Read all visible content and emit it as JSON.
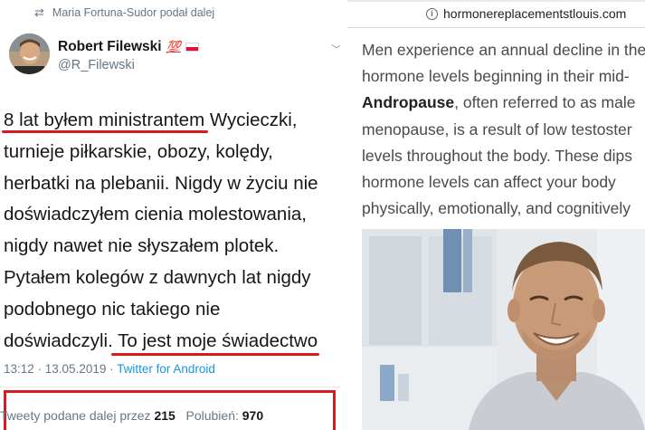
{
  "tweet": {
    "retweet_label": "Maria Fortuna-Sudor podał dalej",
    "author_name": "Robert Filewski",
    "author_badge": "💯",
    "handle": "@R_Filewski",
    "text_lines": [
      {
        "underlined": "8 lat byłem ministrantem",
        "rest": " Wycieczki,"
      },
      {
        "text": "turnieje piłkarskie, obozy, kolędy,"
      },
      {
        "text": "herbatki na plebanii. Nigdy w życiu nie"
      },
      {
        "text": "doświadczyłem cienia molestowania,"
      },
      {
        "text": "nigdy nawet nie słyszałem plotek."
      },
      {
        "text": "Pytałem kolegów z dawnych lat nigdy"
      },
      {
        "text": "podobnego nic takiego nie"
      },
      {
        "prefix": "doświadczyli.",
        "underlined": " To jest moje świadectwo"
      }
    ],
    "timestamp": "13:12 · 13.05.2019 ·",
    "source": "Twitter for Android",
    "retweets_label": "Tweety podane dalej przez",
    "retweets_count": "215",
    "likes_label": "Polubień:",
    "likes_count": "970",
    "highlight_color": "#d71920"
  },
  "article": {
    "url": "hormonereplacementstlouis.com",
    "lines": [
      {
        "text": "Men experience an annual decline in the"
      },
      {
        "text": "hormone levels beginning in their mid-"
      },
      {
        "bold": "Andropause",
        "rest": ", often referred to as male"
      },
      {
        "text": "menopause, is a result of low testoster"
      },
      {
        "text": "levels throughout the body. These dips"
      },
      {
        "text": "hormone levels can affect your body"
      },
      {
        "text": "physically, emotionally, and cognitively"
      }
    ]
  },
  "icons": {
    "retweet": "retweet-icon",
    "chevron": "chevron-down-icon",
    "info": "info-icon"
  }
}
